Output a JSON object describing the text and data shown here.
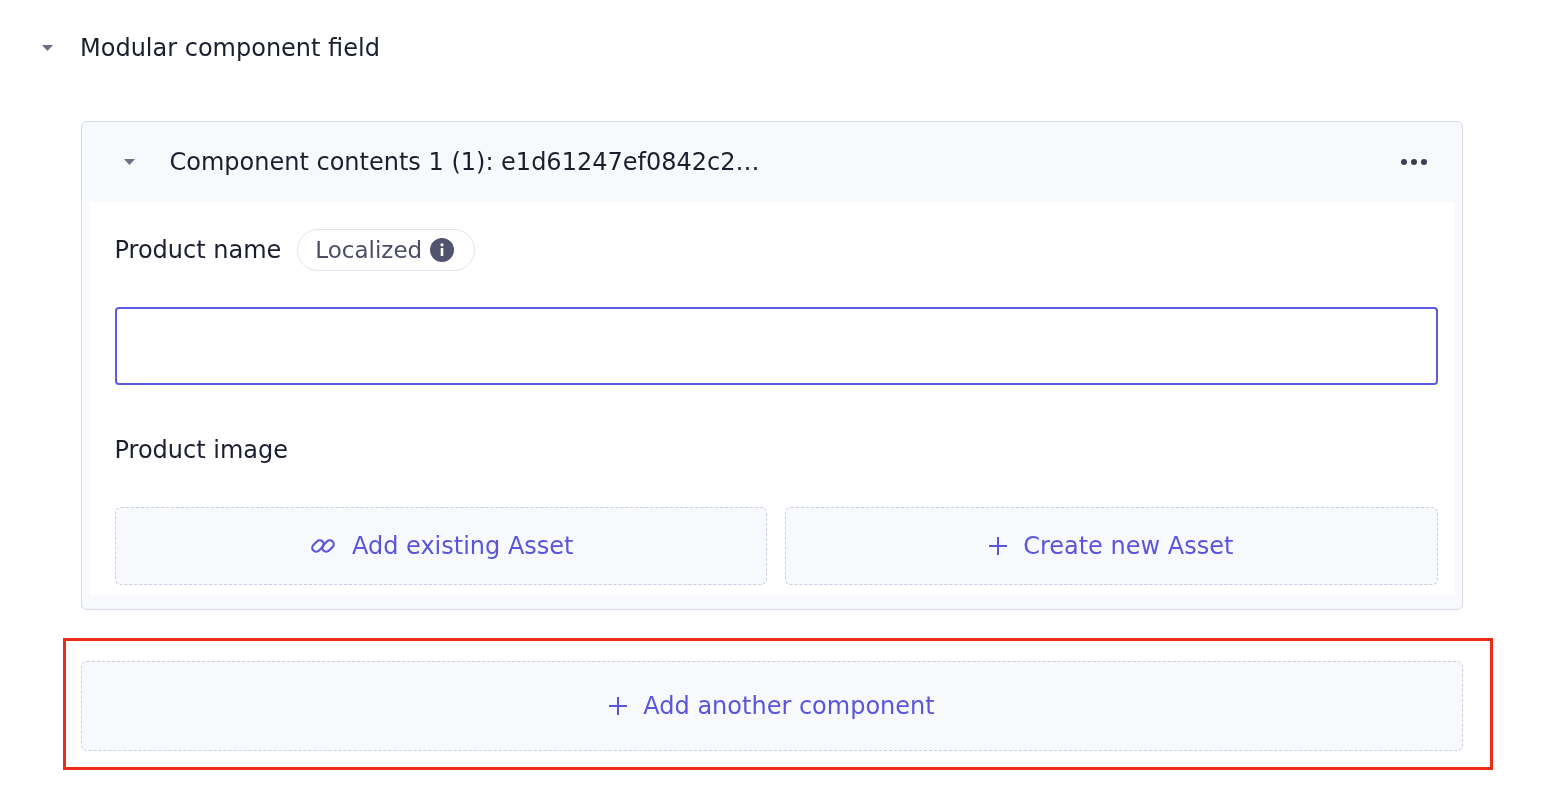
{
  "field": {
    "label": "Modular component field",
    "expanded": true
  },
  "components": [
    {
      "title": "Component contents 1 (1): e1d61247ef0842c2…",
      "expanded": true,
      "fields": [
        {
          "kind": "text",
          "label": "Product name",
          "badge": "Localized",
          "focused": true
        },
        {
          "kind": "asset",
          "label": "Product image",
          "actions": [
            {
              "kind": "link",
              "label": "Add existing Asset"
            },
            {
              "kind": "create",
              "label": "Create new Asset"
            }
          ]
        }
      ]
    }
  ],
  "add_button": {
    "label": "Add another component",
    "highlighted": true
  }
}
